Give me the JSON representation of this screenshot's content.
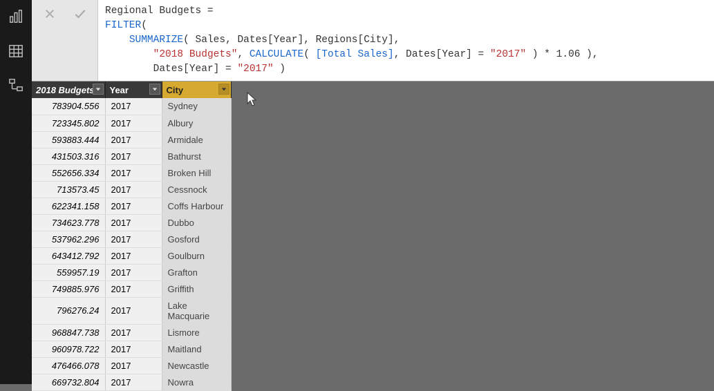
{
  "formula": {
    "line1_name": "Regional Budgets",
    "eq": " =",
    "line2_filter": "FILTER",
    "line2_open": "(",
    "line3_indent": "    ",
    "line3_summarize": "SUMMARIZE",
    "line3_open": "( ",
    "line3_sales": "Sales",
    "line3_c1": ", ",
    "line3_datesyear": "Dates[Year]",
    "line3_c2": ", ",
    "line3_regionscity": "Regions[City]",
    "line3_c3": ",",
    "line4_indent": "        ",
    "line4_str": "\"2018 Budgets\"",
    "line4_c1": ", ",
    "line4_calc": "CALCULATE",
    "line4_open": "( ",
    "line4_totsales": "[Total Sales]",
    "line4_c2": ", ",
    "line4_datesyear": "Dates[Year]",
    "line4_eq": " = ",
    "line4_str2": "\"2017\"",
    "line4_tail": " ) * 1.06 ),",
    "line5_indent": "        ",
    "line5_datesyear": "Dates[Year]",
    "line5_eq": " = ",
    "line5_str": "\"2017\"",
    "line5_tail": " )"
  },
  "columns": {
    "budget": "2018 Budgets",
    "year": "Year",
    "city": "City"
  },
  "rows": [
    {
      "budget": "783904.556",
      "year": "2017",
      "city": "Sydney"
    },
    {
      "budget": "723345.802",
      "year": "2017",
      "city": "Albury"
    },
    {
      "budget": "593883.444",
      "year": "2017",
      "city": "Armidale"
    },
    {
      "budget": "431503.316",
      "year": "2017",
      "city": "Bathurst"
    },
    {
      "budget": "552656.334",
      "year": "2017",
      "city": "Broken Hill"
    },
    {
      "budget": "713573.45",
      "year": "2017",
      "city": "Cessnock"
    },
    {
      "budget": "622341.158",
      "year": "2017",
      "city": "Coffs Harbour"
    },
    {
      "budget": "734623.778",
      "year": "2017",
      "city": "Dubbo"
    },
    {
      "budget": "537962.296",
      "year": "2017",
      "city": "Gosford"
    },
    {
      "budget": "643412.792",
      "year": "2017",
      "city": "Goulburn"
    },
    {
      "budget": "559957.19",
      "year": "2017",
      "city": "Grafton"
    },
    {
      "budget": "749885.976",
      "year": "2017",
      "city": "Griffith"
    },
    {
      "budget": "796276.24",
      "year": "2017",
      "city": "Lake Macquarie"
    },
    {
      "budget": "968847.738",
      "year": "2017",
      "city": "Lismore"
    },
    {
      "budget": "960978.722",
      "year": "2017",
      "city": "Maitland"
    },
    {
      "budget": "476466.078",
      "year": "2017",
      "city": "Newcastle"
    },
    {
      "budget": "669732.804",
      "year": "2017",
      "city": "Nowra"
    }
  ]
}
